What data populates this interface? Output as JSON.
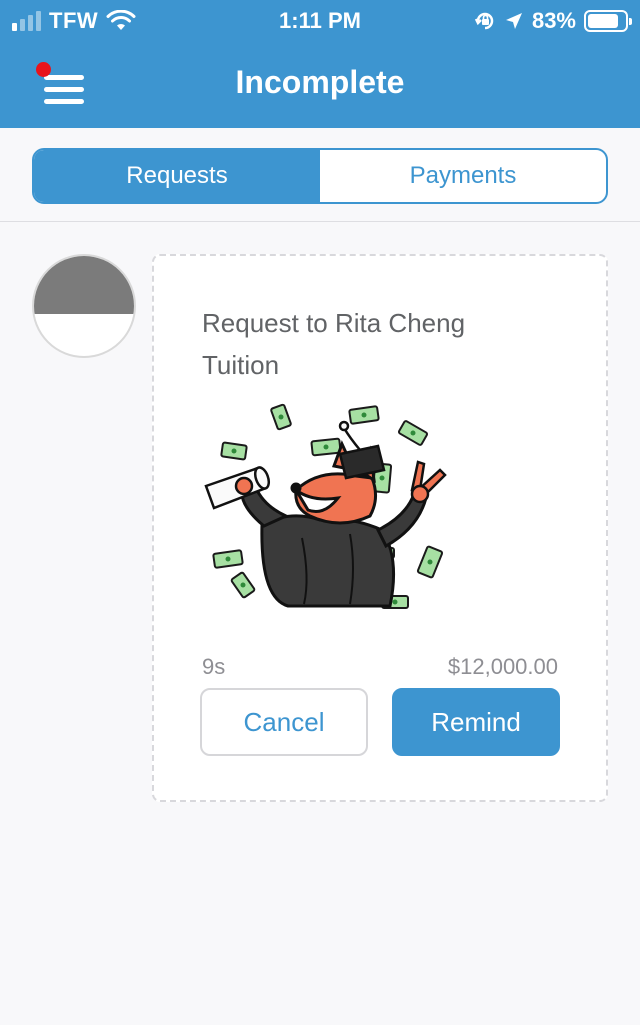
{
  "status_bar": {
    "carrier": "TFW",
    "time": "1:11 PM",
    "battery": "83%",
    "battery_level": 0.83,
    "icons": [
      "signal-icon",
      "wifi-icon",
      "orientation-lock-icon",
      "location-arrow-icon",
      "battery-icon"
    ]
  },
  "nav": {
    "title": "Incomplete",
    "menu_icon": "hamburger-menu-icon",
    "has_notification": true
  },
  "tabs": [
    {
      "label": "Requests",
      "active": true
    },
    {
      "label": "Payments",
      "active": false
    }
  ],
  "request": {
    "title": "Request to Rita Cheng",
    "note": "Tuition",
    "elapsed": "9s",
    "amount": "$12,000.00",
    "illustration": "graduation-fox-money-illustration",
    "cancel_label": "Cancel",
    "remind_label": "Remind"
  },
  "colors": {
    "accent": "#3d95d0",
    "notification": "#e8141c",
    "background": "#f8f8fa",
    "text_secondary": "#8e8e93"
  }
}
